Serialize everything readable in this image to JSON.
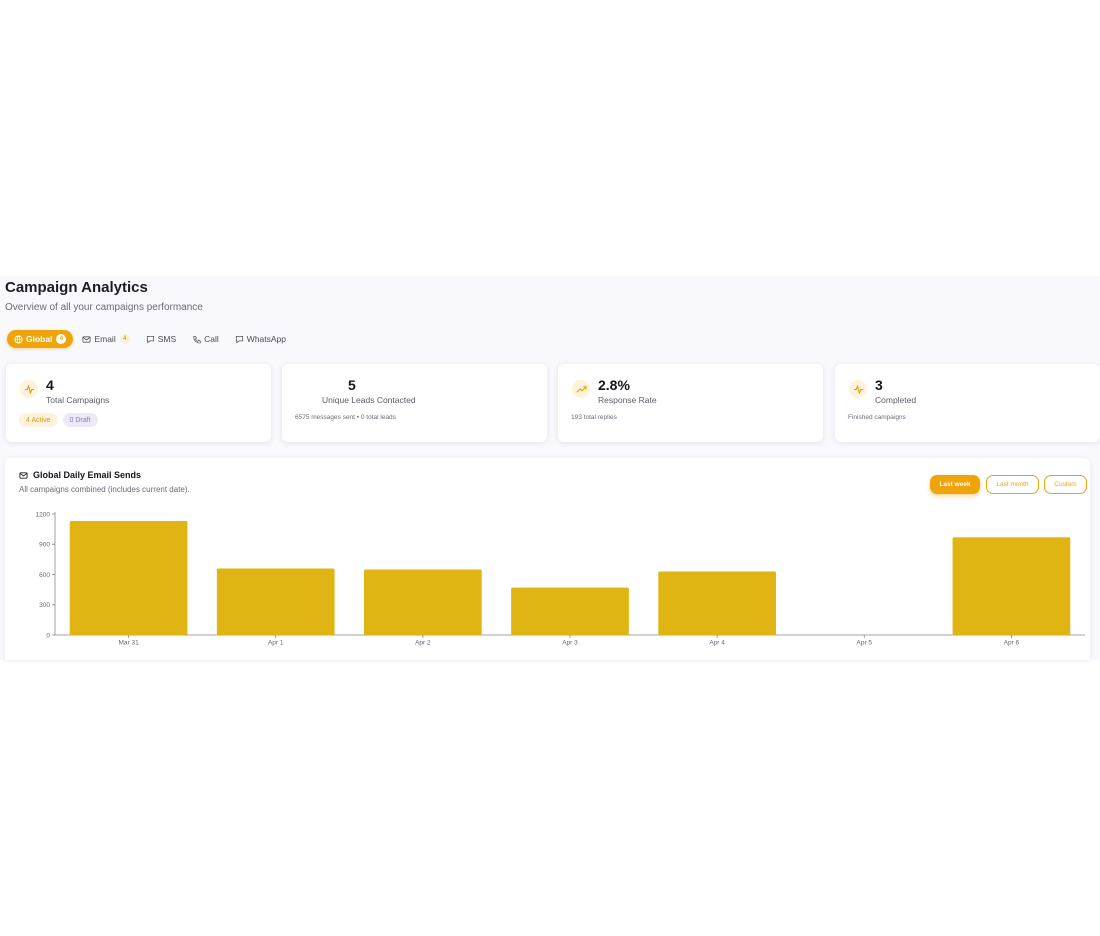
{
  "header": {
    "title": "Campaign Analytics",
    "subtitle": "Overview of all your campaigns performance"
  },
  "tabs": [
    {
      "label": "Global",
      "count": "4",
      "icon": "globe-icon",
      "active": true
    },
    {
      "label": "Email",
      "count": "4",
      "icon": "mail-icon",
      "active": false
    },
    {
      "label": "SMS",
      "icon": "message-icon",
      "active": false
    },
    {
      "label": "Call",
      "icon": "phone-icon",
      "active": false
    },
    {
      "label": "WhatsApp",
      "icon": "message-icon",
      "active": false
    }
  ],
  "stats": [
    {
      "value": "4",
      "label": "Total Campaigns",
      "icon": "activity-icon",
      "badges": {
        "active": "4 Active",
        "draft": "0 Draft"
      }
    },
    {
      "value": "5",
      "label": "Unique Leads Contacted",
      "icon": "users-icon",
      "note": "6575 messages sent • 0 total leads"
    },
    {
      "value": "2.8%",
      "label": "Response Rate",
      "icon": "trending-up-icon",
      "note": "193 total replies"
    },
    {
      "value": "3",
      "label": "Completed",
      "icon": "activity-icon",
      "note": "Finished campaigns"
    }
  ],
  "chart_section": {
    "title": "Global Daily Email Sends",
    "description": "All campaigns combined (includes current date).",
    "ranges": {
      "week": "Last week",
      "month": "Last month",
      "custom": "Custom"
    }
  },
  "colors": {
    "accent": "#eea40a",
    "bar": "#e0b513"
  },
  "chart_data": {
    "type": "bar",
    "categories": [
      "Mar 31",
      "Apr 1",
      "Apr 2",
      "Apr 3",
      "Apr 4",
      "Apr 5",
      "Apr 6"
    ],
    "values": [
      1130,
      660,
      650,
      470,
      630,
      0,
      970
    ],
    "ylim": [
      0,
      1200
    ],
    "yticks": [
      0,
      300,
      600,
      900,
      1200
    ],
    "grid": false
  }
}
